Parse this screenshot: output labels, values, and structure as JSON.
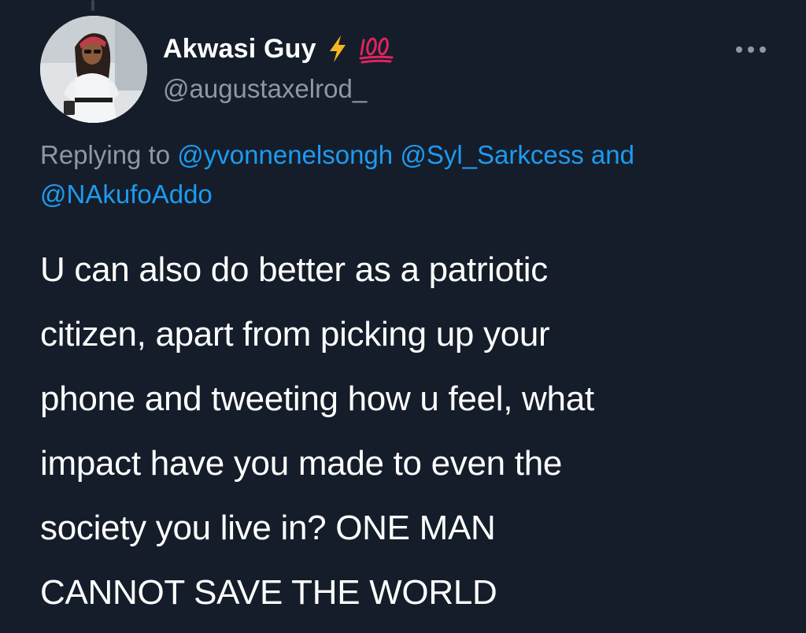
{
  "tweet": {
    "author": {
      "display_name": "Akwasi Guy",
      "handle": "@augustaxelrod_",
      "badges": [
        "lightning-bolt-icon",
        "hundred-points-icon"
      ]
    },
    "reply": {
      "prefix": "Replying to",
      "mentions": [
        "@yvonnenelsongh",
        "@Syl_Sarkcess",
        "@NAkufoAddo"
      ],
      "conjunction": "and"
    },
    "text_lines": [
      "U can also do better as a patriotic",
      "citizen, apart from picking up your",
      "phone and tweeting how u feel, what",
      "impact have you made to even the",
      "society you live in? ONE MAN",
      "CANNOT SAVE THE WORLD"
    ],
    "more_icon": "more-options-icon"
  },
  "colors": {
    "background": "#151d2a",
    "text": "#ffffff",
    "secondary": "#8b98a5",
    "link": "#1d9bf0",
    "bolt": "#f7b51f",
    "hundred": "#e0245e"
  }
}
